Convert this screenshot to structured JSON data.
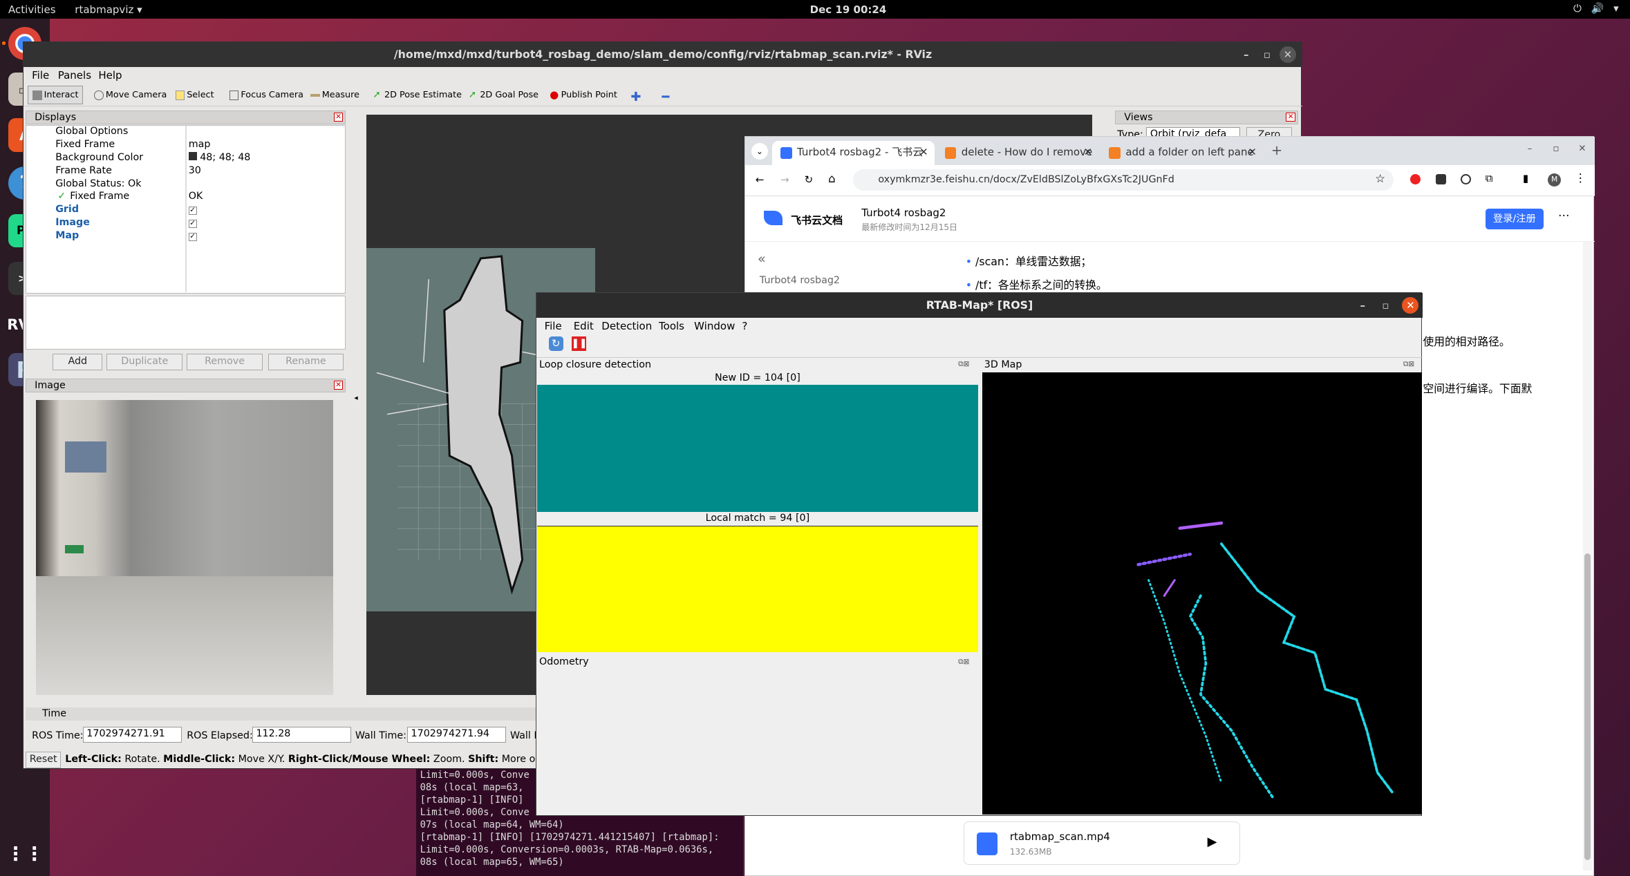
{
  "topbar": {
    "activities": "Activities",
    "app": "rtabmapviz ▾",
    "clock": "Dec 19  00:24",
    "sys": "⏻ 🔊 ▾"
  },
  "rviz": {
    "title": "/home/mxd/mxd/turbot4_rosbag_demo/slam_demo/config/rviz/rtabmap_scan.rviz* - RViz",
    "menu": [
      "File",
      "Panels",
      "Help"
    ],
    "toolbar": [
      "Interact",
      "Move Camera",
      "Select",
      "Focus Camera",
      "Measure",
      "2D Pose Estimate",
      "2D Goal Pose",
      "Publish Point"
    ],
    "displays": {
      "title": "Displays",
      "rows": [
        {
          "k": "Global Options",
          "v": ""
        },
        {
          "k": "Fixed Frame",
          "v": "map"
        },
        {
          "k": "Background Color",
          "v": "48; 48; 48"
        },
        {
          "k": "Frame Rate",
          "v": "30"
        },
        {
          "k": "Global Status: Ok",
          "v": ""
        },
        {
          "k": "Fixed Frame",
          "v": "OK"
        },
        {
          "k": "Grid",
          "v": ""
        },
        {
          "k": "Image",
          "v": ""
        },
        {
          "k": "Map",
          "v": ""
        }
      ],
      "buttons": [
        "Add",
        "Duplicate",
        "Remove",
        "Rename"
      ]
    },
    "image_panel": "Image",
    "views": {
      "title": "Views",
      "type_label": "Type:",
      "type_value": "Orbit (rviz_defa",
      "zero": "Zero"
    },
    "time": {
      "title": "Time",
      "ros_time_label": "ROS Time:",
      "ros_time": "1702974271.91",
      "ros_elapsed_label": "ROS Elapsed:",
      "ros_elapsed": "112.28",
      "wall_time_label": "Wall Time:",
      "wall_time": "1702974271.94",
      "wall_elapsed_label": "Wall E"
    },
    "status": {
      "reset": "Reset",
      "hint_b1": "Left-Click:",
      "hint_t1": " Rotate. ",
      "hint_b2": "Middle-Click:",
      "hint_t2": " Move X/Y. ",
      "hint_b3": "Right-Click/Mouse Wheel:",
      "hint_t3": " Zoom. ",
      "hint_b4": "Shift:",
      "hint_t4": " More options."
    }
  },
  "terminal": {
    "lines": [
      "Limit=0.000s, Conve",
      "08s (local map=63,",
      "[rtabmap-1] [INFO]",
      "Limit=0.000s, Conve",
      "07s (local map=64, WM=64)",
      "[rtabmap-1] [INFO] [1702974271.441215407] [rtabmap]:",
      "Limit=0.000s, Conversion=0.0003s, RTAB-Map=0.0636s,",
      "08s (local map=65, WM=65)"
    ]
  },
  "chrome": {
    "tabs": [
      {
        "label": "Turbot4 rosbag2 - 飞书云",
        "color": "#3370ff"
      },
      {
        "label": "delete - How do I remove",
        "color": "#f48024"
      },
      {
        "label": "add a folder on left pane",
        "color": "#f48024"
      }
    ],
    "url": "oxymkmzr3e.feishu.cn/docx/ZvEldBSlZoLyBfxGXsTc2JUGnFd",
    "site": "飞书云文档",
    "doc_title": "Turbot4 rosbag2",
    "doc_sub": "最新修改时间为12月15日",
    "login": "登录/注册",
    "sidebar_title": "Turbot4 rosbag2",
    "bullets": [
      "/scan：单线雷达数据；",
      "/tf：各坐标系之间的转换。"
    ],
    "frag1": "使用的相对路径。",
    "frag2": "空间进行编译。下面默",
    "file": {
      "name": "rtabmap_scan.mp4",
      "size": "132.63MB"
    }
  },
  "rtab": {
    "title": "RTAB-Map* [ROS]",
    "menu": [
      "File",
      "Edit",
      "Detection",
      "Tools",
      "Window",
      "?"
    ],
    "loop": "Loop closure detection",
    "new_id": "New ID = 104 [0]",
    "local_match": "Local match = 94 [0]",
    "odometry": "Odometry",
    "map3d": "3D Map",
    "colors": {
      "new": "#008b8b",
      "match": "#ffff00"
    }
  }
}
